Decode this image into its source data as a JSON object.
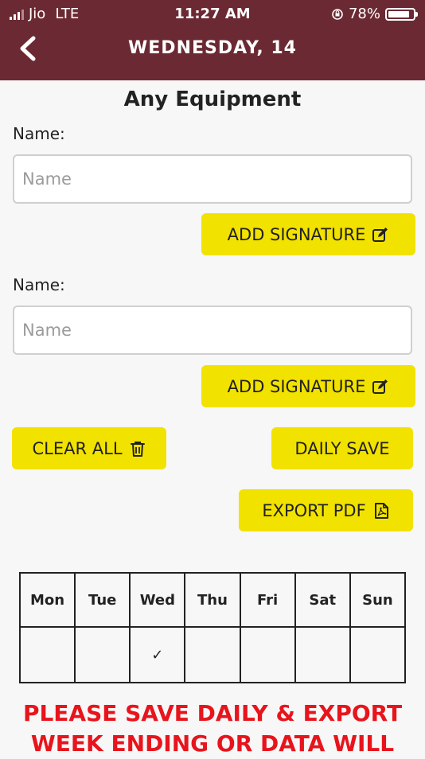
{
  "status_bar": {
    "carrier": "Jio",
    "network": "LTE",
    "time": "11:27 AM",
    "battery": "78%"
  },
  "header": {
    "title": "WEDNESDAY,  14"
  },
  "section_title": "Any Equipment",
  "signatures": [
    {
      "label": "Name:",
      "placeholder": "Name",
      "value": "",
      "button": "ADD SIGNATURE"
    },
    {
      "label": "Name:",
      "placeholder": "Name",
      "value": "",
      "button": "ADD SIGNATURE"
    }
  ],
  "actions": {
    "clear_all": "CLEAR ALL",
    "daily_save": "DAILY SAVE",
    "export_pdf": "EXPORT PDF"
  },
  "week": {
    "days": [
      "Mon",
      "Tue",
      "Wed",
      "Thu",
      "Fri",
      "Sat",
      "Sun"
    ],
    "marks": [
      "",
      "",
      "✓",
      "",
      "",
      "",
      ""
    ]
  },
  "warning": {
    "line1": "PLEASE SAVE DAILY & EXPORT",
    "line2": "WEEK ENDING OR DATA WILL"
  },
  "colors": {
    "header_bg": "#6b2a33",
    "button_bg": "#f2e200",
    "warning_text": "#e8141c"
  },
  "icons": {
    "back": "chevron-left-icon",
    "signature": "edit-icon",
    "clear": "trash-icon",
    "pdf": "pdf-file-icon"
  }
}
